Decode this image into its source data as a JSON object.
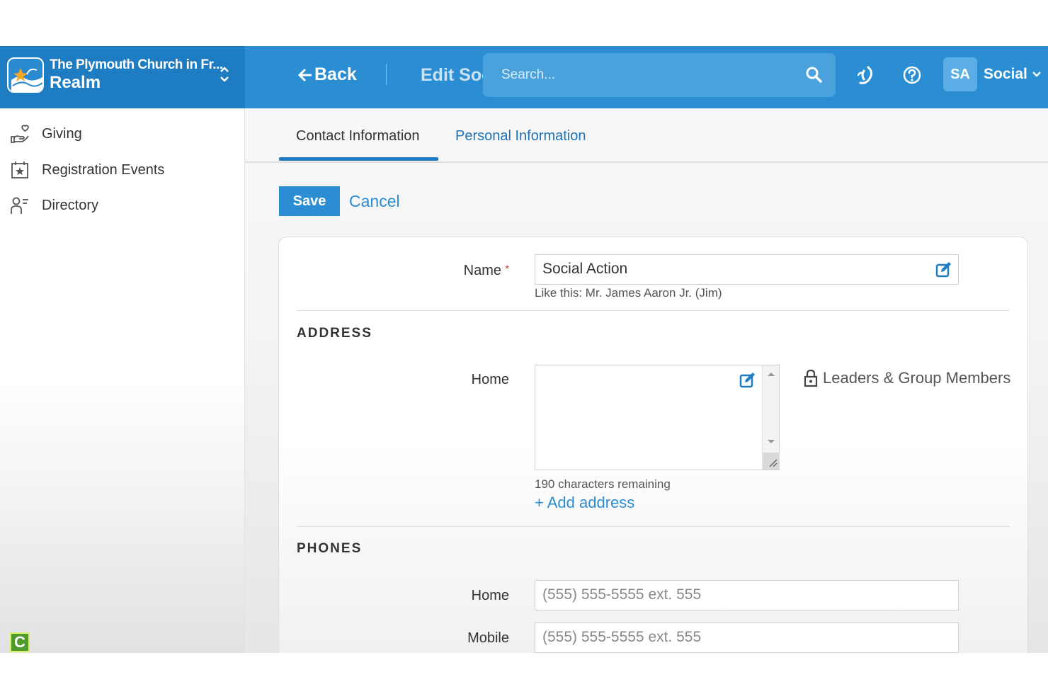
{
  "header": {
    "org_name": "The Plymouth Church in Fr...",
    "product_name": "Realm",
    "back_label": "Back",
    "page_title": "Edit Social Action",
    "search_placeholder": "Search...",
    "avatar_initials": "SA",
    "user_label": "Social",
    "brand_color": "#2b8ed3"
  },
  "sidebar": {
    "items": [
      {
        "label": "Giving",
        "icon": "giving-hand-heart-icon"
      },
      {
        "label": "Registration Events",
        "icon": "calendar-star-icon"
      },
      {
        "label": "Directory",
        "icon": "person-list-icon"
      }
    ],
    "badge_letter": "C"
  },
  "tabs": {
    "active": "Contact Information",
    "other": "Personal Information"
  },
  "actions": {
    "save_label": "Save",
    "cancel_label": "Cancel"
  },
  "form": {
    "name_label": "Name",
    "name_required_mark": "*",
    "name_value": "Social Action",
    "name_hint": "Like this: Mr. James Aaron Jr. (Jim)",
    "address_section_title": "ADDRESS",
    "address_home_label": "Home",
    "address_chars_remaining": "190 characters remaining",
    "privacy_label": "Leaders & Group Members",
    "add_address_label": "+ Add address",
    "phones_section_title": "PHONES",
    "phone_home_label": "Home",
    "phone_home_placeholder": "(555) 555-5555 ext. 555",
    "phone_mobile_label": "Mobile",
    "phone_mobile_placeholder": "(555) 555-5555 ext. 555"
  }
}
